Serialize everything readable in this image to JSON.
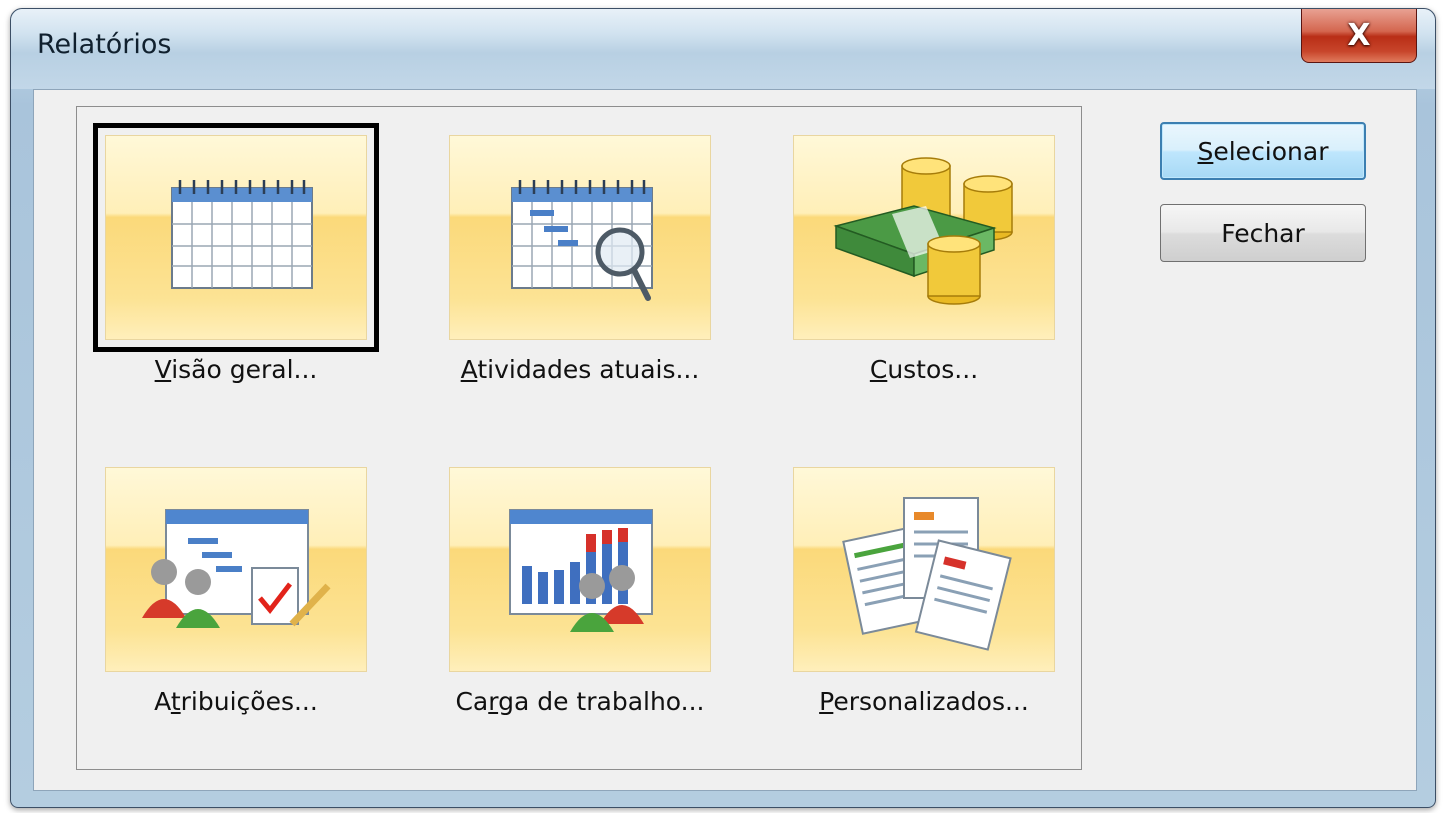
{
  "window": {
    "title": "Relatórios",
    "close_glyph": "X"
  },
  "reports": [
    {
      "id": "visao-geral",
      "prefix": "",
      "accel": "V",
      "rest": "isão geral...",
      "icon": "calendar-icon",
      "selected": true
    },
    {
      "id": "atividades-atuais",
      "prefix": "",
      "accel": "A",
      "rest": "tividades atuais...",
      "icon": "calendar-search-icon",
      "selected": false
    },
    {
      "id": "custos",
      "prefix": "",
      "accel": "C",
      "rest": "ustos...",
      "icon": "money-coins-icon",
      "selected": false
    },
    {
      "id": "atribuicoes",
      "prefix": "A",
      "accel": "t",
      "rest": "ribuições...",
      "icon": "people-tasks-icon",
      "selected": false
    },
    {
      "id": "carga-de-trabalho",
      "prefix": "Ca",
      "accel": "r",
      "rest": "ga de trabalho...",
      "icon": "workload-chart-icon",
      "selected": false
    },
    {
      "id": "personalizados",
      "prefix": "",
      "accel": "P",
      "rest": "ersonalizados...",
      "icon": "documents-icon",
      "selected": false
    }
  ],
  "buttons": {
    "select": {
      "accel": "S",
      "rest": "elecionar"
    },
    "close": {
      "label": "Fechar"
    }
  }
}
